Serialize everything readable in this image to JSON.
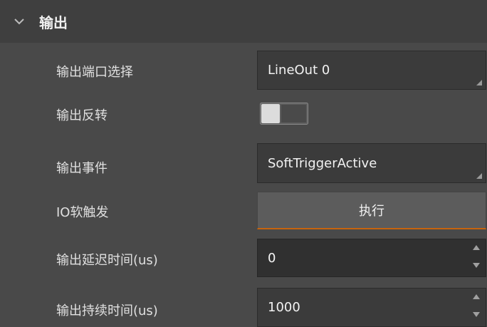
{
  "section": {
    "title": "输出",
    "expanded_icon": "chevron-down-icon"
  },
  "rows": {
    "output_port": {
      "label": "输出端口选择",
      "value": "LineOut 0"
    },
    "output_invert": {
      "label": "输出反转",
      "checked": false
    },
    "output_event": {
      "label": "输出事件",
      "value": "SoftTriggerActive"
    },
    "io_soft_trigger": {
      "label": "IO软触发",
      "button_label": "执行"
    },
    "output_delay": {
      "label": "输出延迟时间(us)",
      "value": "0"
    },
    "output_duration": {
      "label": "输出持续时间(us)",
      "value": "1000"
    }
  },
  "colors": {
    "background": "#494949",
    "header_background": "#3f3f3f",
    "field_background": "#3b3b3b",
    "button_accent": "#c7640d"
  }
}
